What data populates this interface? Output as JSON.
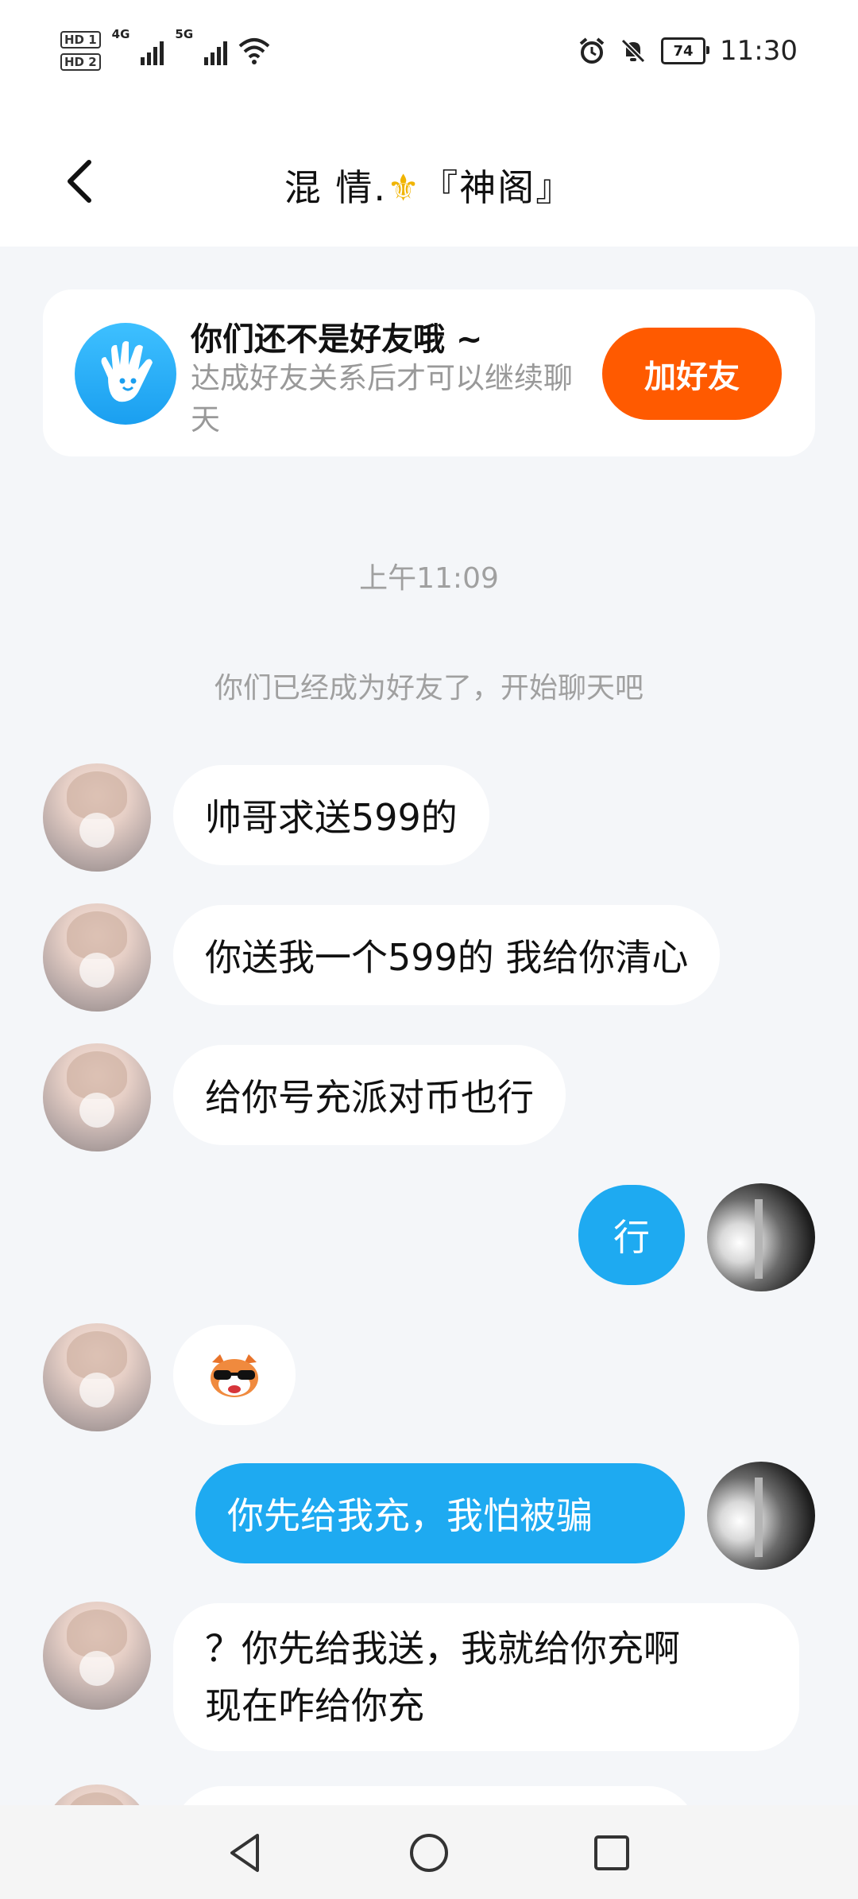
{
  "status_bar": {
    "hd1": "HD 1",
    "hd2": "HD 2",
    "net1": "4G",
    "net2": "5G",
    "battery": "74",
    "time": "11:30"
  },
  "header": {
    "title_part1": "混  情.",
    "title_part2": "『神阁』"
  },
  "friend_card": {
    "title": "你们还不是好友哦 ~",
    "subtitle": "达成好友关系后才可以继续聊天",
    "button": "加好友"
  },
  "time_separator": "上午11:09",
  "system_message": "你们已经成为好友了，开始聊天吧",
  "messages": [
    {
      "sender": "other",
      "text": "帅哥求送599的"
    },
    {
      "sender": "other",
      "text": "你送我一个599的 我给你清心"
    },
    {
      "sender": "other",
      "text": "给你号充派对币也行"
    },
    {
      "sender": "me",
      "text": "行"
    },
    {
      "sender": "other",
      "text": "",
      "emoji": "sunglasses-face-sticker"
    },
    {
      "sender": "me",
      "text": "你先给我充，我怕被骗"
    },
    {
      "sender": "other",
      "line1": "？你先给我送，我就给你充啊",
      "line2": "现在咋给你充"
    }
  ],
  "colors": {
    "accent": "#1eaaf1",
    "add_friend": "#ff5a00",
    "background": "#f4f6f9"
  }
}
